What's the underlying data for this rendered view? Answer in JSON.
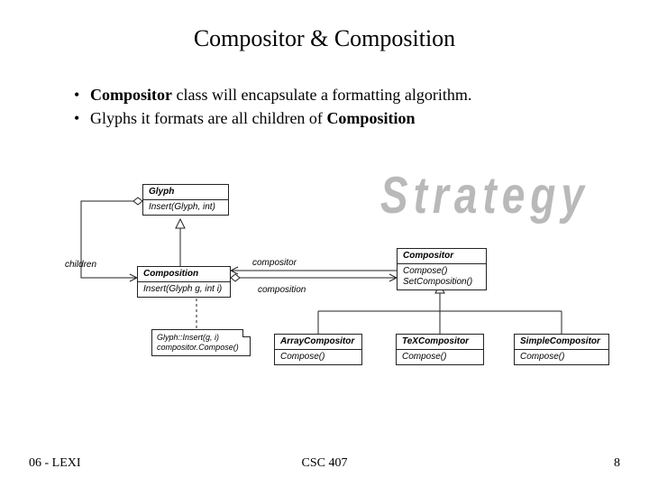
{
  "title": "Compositor & Composition",
  "bullet1_bold": "Compositor",
  "bullet1_rest": " class will encapsulate a formatting algorithm.",
  "bullet2_pre": "Glyphs it formats are all children of ",
  "bullet2_bold": "Composition",
  "footer": {
    "left": "06 - LEXI",
    "center": "CSC 407",
    "right": "8"
  },
  "strategy": "Strategy",
  "labels": {
    "children": "children",
    "compositor_role": "compositor",
    "composition_role": "composition"
  },
  "classes": {
    "glyph": {
      "name": "Glyph",
      "op": "Insert(Glyph, int)"
    },
    "composition": {
      "name": "Composition",
      "op": "Insert(Glyph g, int i)"
    },
    "compositor": {
      "name": "Compositor",
      "op1": "Compose()",
      "op2": "SetComposition()"
    },
    "array": {
      "name": "ArrayCompositor",
      "op": "Compose()"
    },
    "tex": {
      "name": "TeXCompositor",
      "op": "Compose()"
    },
    "simple": {
      "name": "SimpleCompositor",
      "op": "Compose()"
    }
  },
  "note": {
    "l1": "Glyph::Insert(g, i)",
    "l2": "compositor.Compose()"
  }
}
